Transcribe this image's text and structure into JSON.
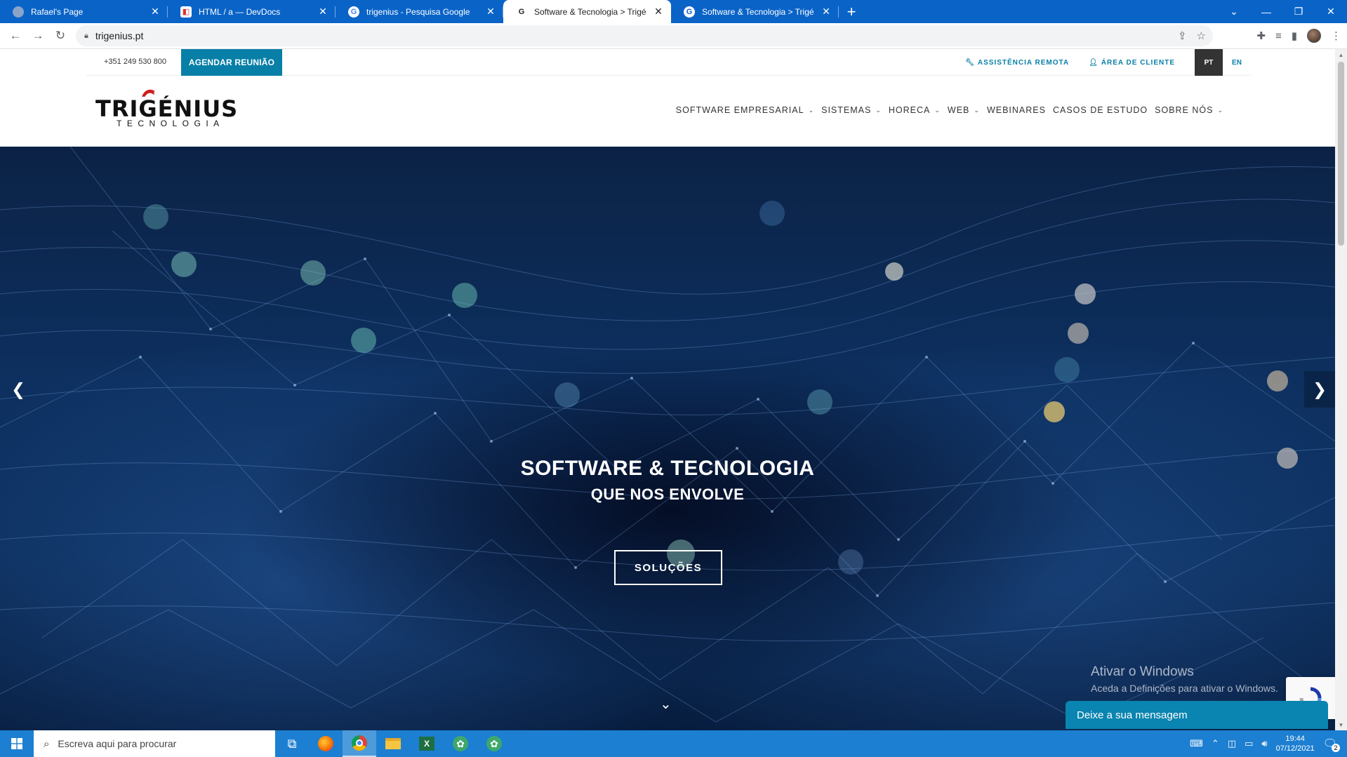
{
  "browser": {
    "tabs": [
      {
        "title": "Rafael's Page",
        "favicon": "page-icon",
        "active": false
      },
      {
        "title": "HTML / a — DevDocs",
        "favicon": "devdocs-icon",
        "active": false
      },
      {
        "title": "trigenius - Pesquisa Google",
        "favicon": "google-icon",
        "active": false
      },
      {
        "title": "Software & Tecnologia > Trigénius",
        "favicon": "google-icon",
        "active": true
      },
      {
        "title": "Software & Tecnologia > Trigénius",
        "favicon": "google-icon",
        "active": false
      }
    ],
    "url": "trigenius.pt"
  },
  "site": {
    "phone": "+351 249 530 800",
    "meeting_button": "AGENDAR REUNIÃO",
    "remote_assist": "ASSISTÊNCIA REMOTA",
    "client_area": "ÁREA DE CLIENTE",
    "languages": [
      "PT",
      "EN"
    ],
    "active_language": "PT",
    "logo": {
      "name": "TRIGÉNIUS",
      "sub": "TECNOLOGIA"
    },
    "nav": [
      {
        "label": "SOFTWARE EMPRESARIAL",
        "dropdown": true
      },
      {
        "label": "SISTEMAS",
        "dropdown": true
      },
      {
        "label": "HORECA",
        "dropdown": true
      },
      {
        "label": "WEB",
        "dropdown": true
      },
      {
        "label": "WEBINARES",
        "dropdown": false
      },
      {
        "label": "CASOS DE ESTUDO",
        "dropdown": false
      },
      {
        "label": "SOBRE NÓS",
        "dropdown": true
      }
    ],
    "hero": {
      "title": "SOFTWARE & TECNOLOGIA",
      "subtitle": "QUE NOS ENVOLVE",
      "button": "SOLUÇÕES"
    },
    "chat_label": "Deixe a sua mensagem",
    "accent_color": "#087fa7"
  },
  "windows": {
    "activate_title": "Ativar o Windows",
    "activate_sub": "Aceda a Definições para ativar o Windows.",
    "search_placeholder": "Escreva aqui para procurar",
    "time": "19:44",
    "date": "07/12/2021",
    "notifications": "2"
  }
}
